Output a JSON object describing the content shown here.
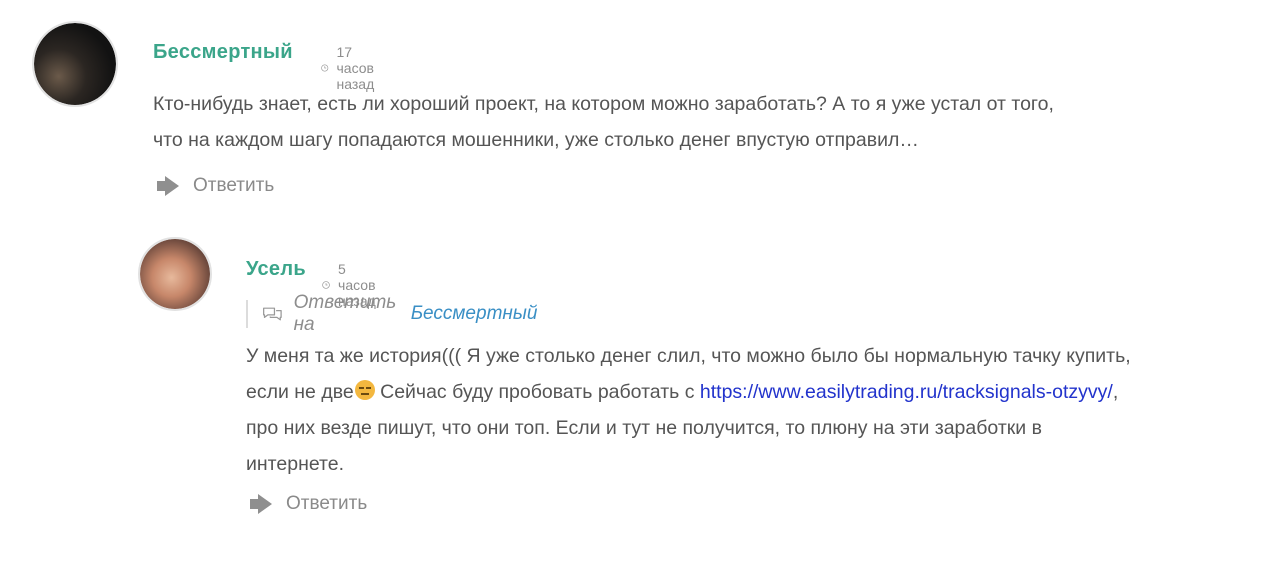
{
  "comments": [
    {
      "author": "Бессмертный",
      "time": "17 часов назад",
      "text_lines": [
        "Кто-нибудь знает, есть ли хороший проект, на котором можно заработать? А то я уже устал от того,",
        "что на каждом шагу попадаются мошенники, уже столько денег впустую отправил…"
      ],
      "reply_label": "Ответить"
    },
    {
      "author": "Усель",
      "time": "5 часов назад",
      "reply_to_prefix": "Ответить на",
      "reply_to_author": "Бессмертный",
      "line1": "У меня та же история((( Я уже столько денег слил, что можно было бы нормальную тачку купить,",
      "line2_before": "если не две",
      "line2_after_emoji": " Сейчас буду пробовать работать с ",
      "link": "https://www.easilytrading.ru/tracksignals-otzyvy/",
      "line2_end": ",",
      "line3": "про них везде пишут, что они топ. Если и тут не получится, то плюну на эти заработки в",
      "line4": "интернете.",
      "reply_label": "Ответить"
    }
  ],
  "icons": {
    "time": "clock-icon",
    "reply": "reply-arrow-icon",
    "reply_to": "speech-bubbles-icon",
    "emoji": "unamused-face-emoji"
  },
  "colors": {
    "author": "#3ba58a",
    "link": "#2233cc",
    "reply_to_link": "#3a8fc5"
  }
}
